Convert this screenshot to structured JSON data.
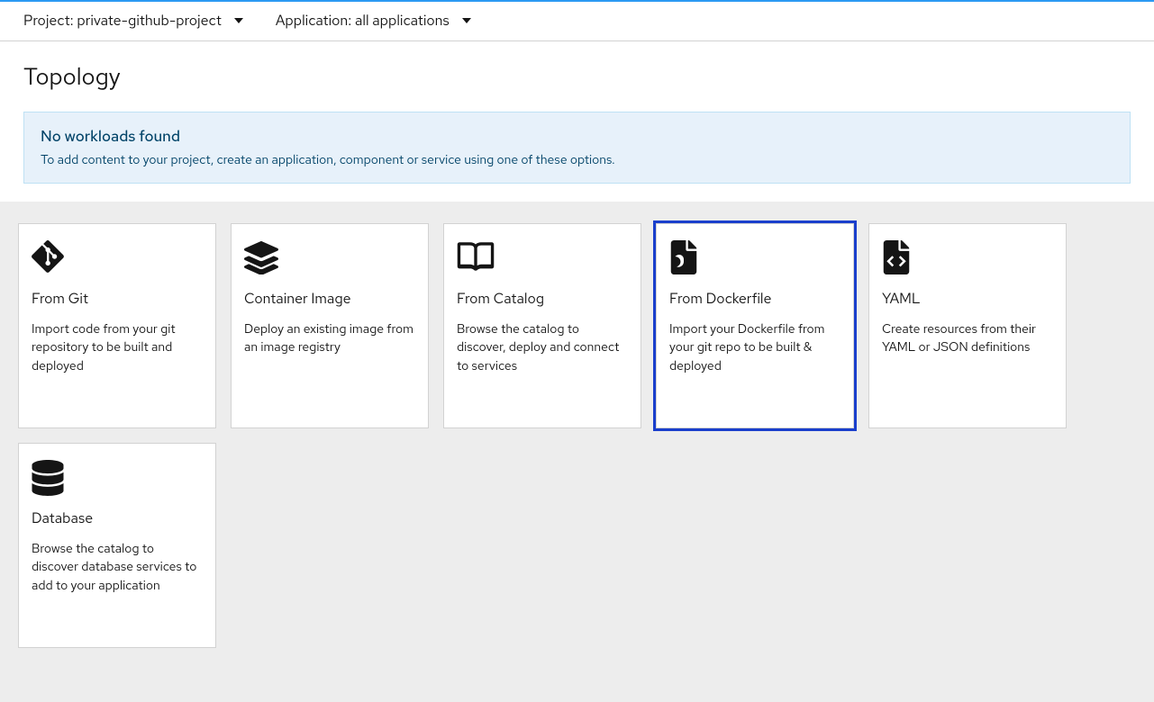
{
  "contextBar": {
    "project": {
      "label": "Project:",
      "value": "private-github-project"
    },
    "application": {
      "label": "Application:",
      "value": "all applications"
    }
  },
  "page": {
    "title": "Topology"
  },
  "banner": {
    "title": "No workloads found",
    "text": "To add content to your project, create an application, component or service using one of these options."
  },
  "cards": [
    {
      "id": "from-git",
      "icon": "git-icon",
      "title": "From Git",
      "desc": "Import code from your git repository to be built and deployed",
      "highlighted": false
    },
    {
      "id": "container-image",
      "icon": "layers-icon",
      "title": "Container Image",
      "desc": "Deploy an existing image from an image registry",
      "highlighted": false
    },
    {
      "id": "from-catalog",
      "icon": "catalog-icon",
      "title": "From Catalog",
      "desc": "Browse the catalog to discover, deploy and connect to services",
      "highlighted": false
    },
    {
      "id": "from-dockerfile",
      "icon": "dockerfile-icon",
      "title": "From Dockerfile",
      "desc": "Import your Dockerfile from your git repo to be built & deployed",
      "highlighted": true
    },
    {
      "id": "yaml",
      "icon": "code-file-icon",
      "title": "YAML",
      "desc": "Create resources from their YAML or JSON definitions",
      "highlighted": false
    },
    {
      "id": "database",
      "icon": "database-icon",
      "title": "Database",
      "desc": "Browse the catalog to discover database services to add to your application",
      "highlighted": false
    }
  ]
}
